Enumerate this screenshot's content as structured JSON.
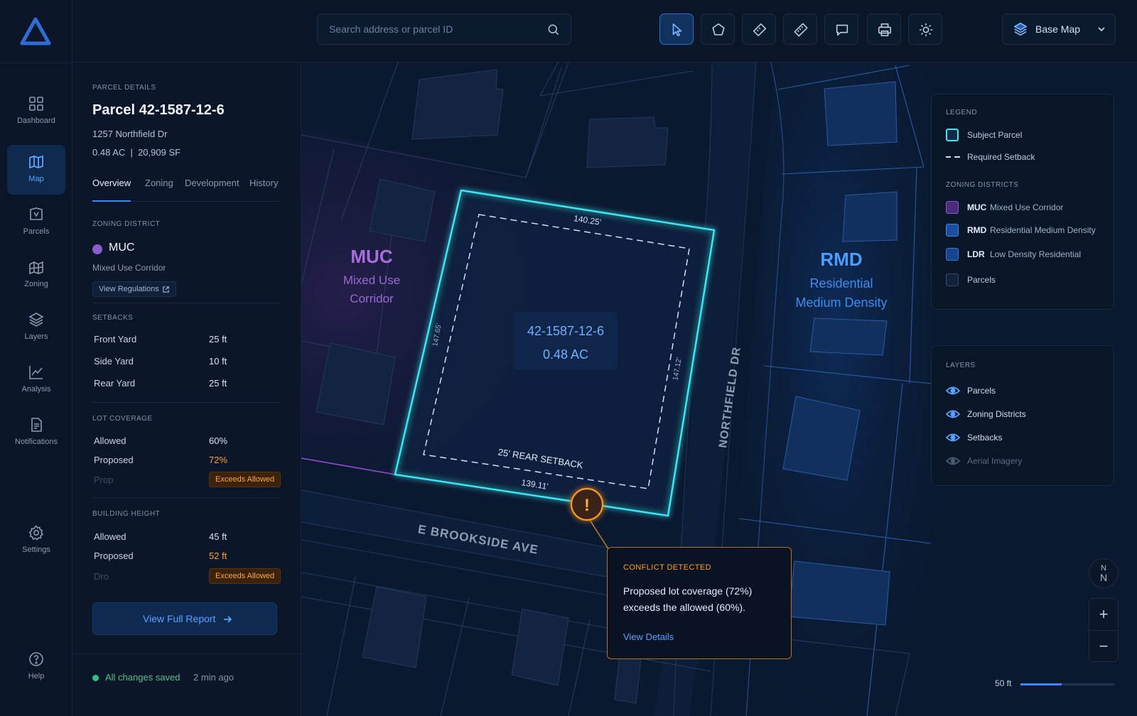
{
  "nav": {
    "items": [
      {
        "label": "Dashboard",
        "icon": "grid-icon"
      },
      {
        "label": "Map",
        "icon": "map-icon",
        "active": true
      },
      {
        "label": "Parcels",
        "icon": "parcel-icon"
      },
      {
        "label": "Zoning",
        "icon": "zoning-icon"
      },
      {
        "label": "Layers",
        "icon": "layers-icon"
      },
      {
        "label": "Analysis",
        "icon": "analysis-icon"
      },
      {
        "label": "Notifications",
        "icon": "document-icon"
      }
    ],
    "settings": "Settings",
    "help": "Help"
  },
  "search": {
    "placeholder": "Search address or parcel ID"
  },
  "toolbar": {
    "tools": [
      "select-tool",
      "polygon-tool",
      "measure-tool",
      "ruler-tool",
      "comment-tool",
      "print-tool",
      "theme-tool"
    ],
    "basemap_label": "Base Map"
  },
  "panel": {
    "eyebrow": "PARCEL DETAILS",
    "title": "Parcel 42-1587-12-6",
    "address": "1257 Northfield Dr",
    "size": "0.48 AC  |  20,909 SF",
    "tabs": [
      "Overview",
      "Zoning",
      "Development",
      "History"
    ],
    "zoning": {
      "heading": "ZONING DISTRICT",
      "code": "MUC",
      "name": "Mixed Use Corridor",
      "regulations_label": "View Regulations",
      "color": "#8a5cd0"
    },
    "setbacks": {
      "heading": "SETBACKS",
      "rows": [
        {
          "label": "Front Yard",
          "value": "25 ft"
        },
        {
          "label": "Side Yard",
          "value": "10 ft"
        },
        {
          "label": "Rear Yard",
          "value": "25 ft"
        }
      ]
    },
    "lot_coverage": {
      "heading": "LOT COVERAGE",
      "allowed_label": "Allowed",
      "allowed": "60%",
      "proposed_label": "Proposed",
      "proposed": "72%",
      "ghost": "Prop",
      "badge": "Exceeds Allowed"
    },
    "building_height": {
      "heading": "BUILDING HEIGHT",
      "allowed_label": "Allowed",
      "allowed": "45 ft",
      "proposed_label": "Proposed",
      "proposed": "52 ft",
      "ghost": "Dro",
      "badge": "Exceeds Allowed"
    },
    "report_label": "View Full Report",
    "status": {
      "saved": "All changes saved",
      "time": "2 min ago"
    }
  },
  "map": {
    "zone_left": {
      "code": "MUC",
      "line1": "Mixed Use",
      "line2": "Corridor"
    },
    "zone_right": {
      "code": "RMD",
      "line1": "Residential",
      "line2": "Medium Density"
    },
    "parcel_id": "42-1587-12-6",
    "parcel_area": "0.48 AC",
    "dim_top": "140.25'",
    "dim_bottom": "139.11'",
    "dim_left": "147.65'",
    "dim_right": "147.12'",
    "rear_setback": "25' REAR SETBACK",
    "street_1": "E BROOKSIDE AVE",
    "street_2": "NORTHFIELD DR"
  },
  "legend": {
    "heading": "LEGEND",
    "subject": "Subject Parcel",
    "setback": "Required Setback",
    "districts_heading": "ZONING DISTRICTS",
    "districts": [
      {
        "code": "MUC",
        "name": "Mixed Use Corridor",
        "color": "#6b3fa8"
      },
      {
        "code": "RMD",
        "name": "Residential Medium Density",
        "color": "#1e5bb8"
      },
      {
        "code": "LDR",
        "name": "Low Density Residential",
        "color": "#1d4e9e"
      }
    ],
    "parcels": "Parcels"
  },
  "layers": {
    "heading": "LAYERS",
    "items": [
      {
        "label": "Parcels",
        "on": true
      },
      {
        "label": "Zoning Districts",
        "on": true
      },
      {
        "label": "Setbacks",
        "on": true
      },
      {
        "label": "Aerial Imagery",
        "on": false
      }
    ]
  },
  "controls": {
    "north_1": "N",
    "north_2": "N",
    "zoom_in": "+",
    "zoom_out": "−",
    "scale_label": "50 ft",
    "scale_fraction": 0.44
  },
  "conflict": {
    "heading": "CONFLICT DETECTED",
    "body": "Proposed lot coverage (72%) exceeds the allowed (60%).",
    "link": "View Details",
    "marker": "!"
  },
  "colors": {
    "accent": "#3b86ff",
    "parcel": "#3ee6f5",
    "warn": "#ff9f2e",
    "muc": "#a86ee0",
    "rmd": "#4f9cff"
  }
}
